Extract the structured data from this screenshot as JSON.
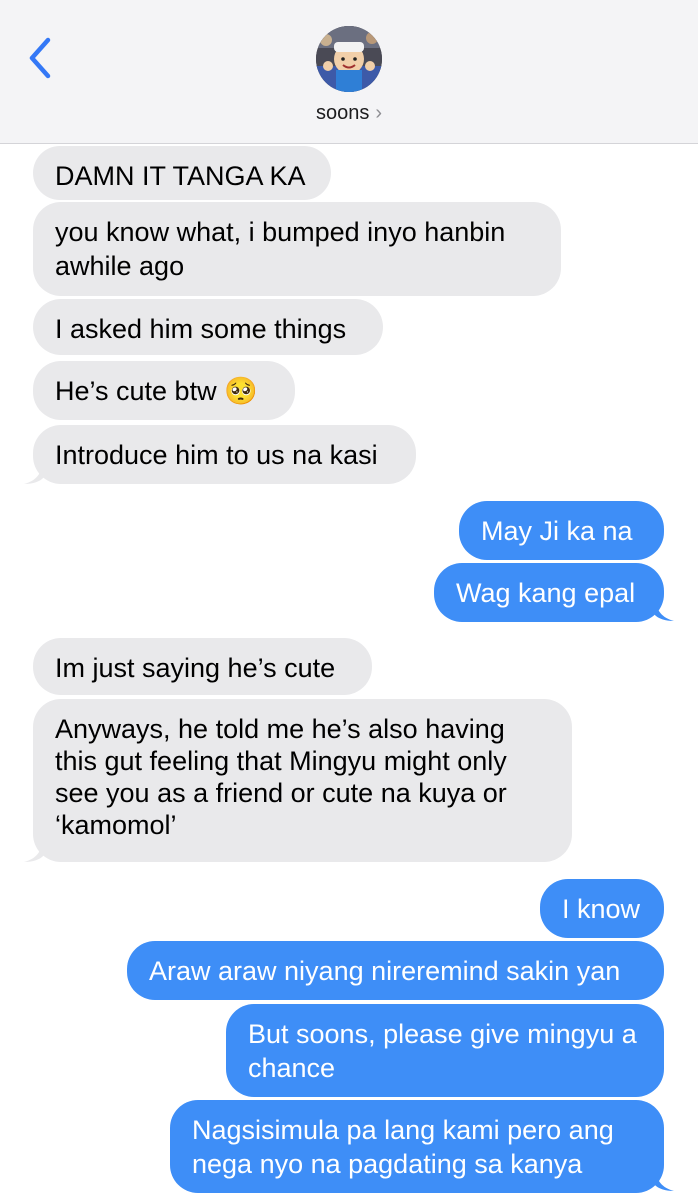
{
  "header": {
    "contact_name": "soons",
    "chevron": "›"
  },
  "colors": {
    "incoming_bubble": "#e9e9eb",
    "outgoing_bubble": "#3e8ef7",
    "accent": "#3478f6",
    "header_bg": "#f4f4f6"
  },
  "messages": [
    {
      "dir": "in",
      "text": "DAMN IT TANGA KA"
    },
    {
      "dir": "in",
      "text": "you know what, i bumped inyo hanbin awhile ago"
    },
    {
      "dir": "in",
      "text": "I asked him some things"
    },
    {
      "dir": "in",
      "text": "He’s cute btw 🥺"
    },
    {
      "dir": "in",
      "text": "Introduce him to us na kasi"
    },
    {
      "dir": "out",
      "text": "May Ji ka na"
    },
    {
      "dir": "out",
      "text": "Wag kang epal"
    },
    {
      "dir": "in",
      "text": "Im just saying he’s cute"
    },
    {
      "dir": "in",
      "text": "Anyways, he told me he’s also having this gut feeling that Mingyu might only see you as a friend or cute na kuya or ‘kamomol’"
    },
    {
      "dir": "out",
      "text": "I know"
    },
    {
      "dir": "out",
      "text": "Araw araw niyang nireremind sakin yan"
    },
    {
      "dir": "out",
      "text": "But soons, please give mingyu a chance"
    },
    {
      "dir": "out",
      "text": "Nagsisimula pa lang kami pero ang nega nyo na pagdating sa kanya"
    }
  ]
}
